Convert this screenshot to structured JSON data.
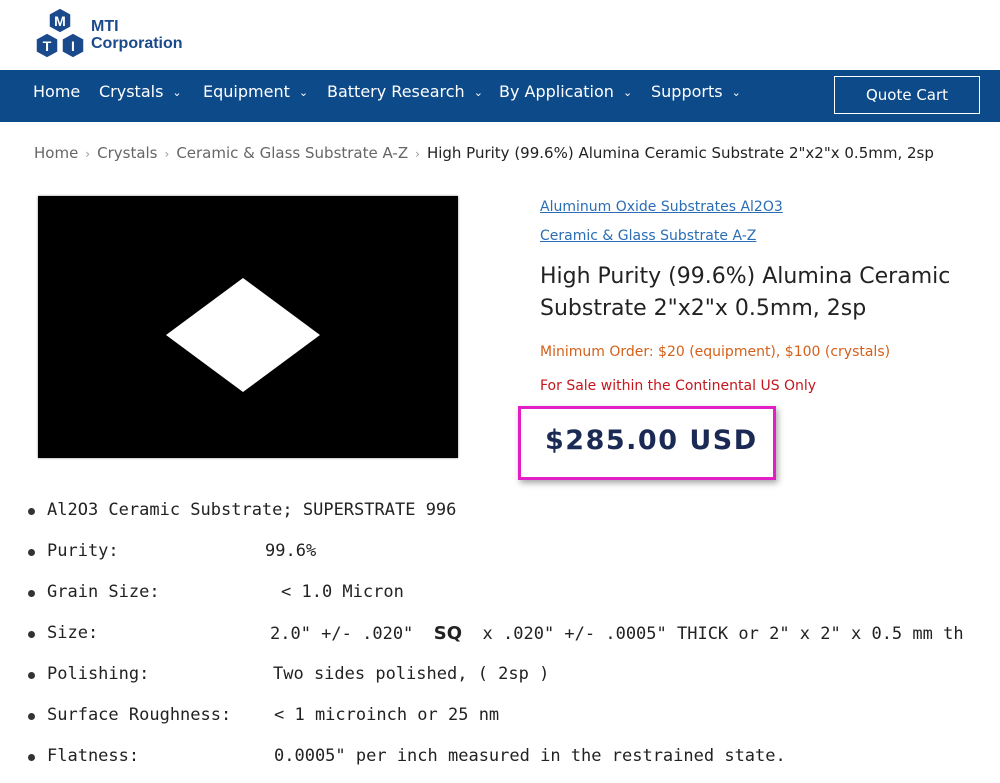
{
  "brand": {
    "logo_letters": [
      "M",
      "T",
      "I"
    ],
    "name_line1": "MTI",
    "name_line2": "Corporation",
    "color": "#1a4a8c"
  },
  "nav": {
    "items": [
      {
        "label": "Home",
        "has_dropdown": false
      },
      {
        "label": "Crystals",
        "has_dropdown": true
      },
      {
        "label": "Equipment",
        "has_dropdown": true
      },
      {
        "label": "Battery Research",
        "has_dropdown": true
      },
      {
        "label": "By Application",
        "has_dropdown": true
      },
      {
        "label": "Supports",
        "has_dropdown": true
      }
    ],
    "quote_cart": "Quote Cart",
    "background": "#0d4a8a"
  },
  "breadcrumb": {
    "items": [
      "Home",
      "Crystals",
      "Ceramic & Glass Substrate A-Z"
    ],
    "current": "High Purity (99.6%) Alumina Ceramic Substrate 2\"x2\"x 0.5mm, 2sp",
    "separator": "›"
  },
  "product": {
    "category_links": [
      "Aluminum Oxide Substrates Al2O3",
      "Ceramic & Glass Substrate A-Z"
    ],
    "title": "High Purity (99.6%) Alumina Ceramic Substrate 2\"x2\"x 0.5mm, 2sp",
    "min_order": "Minimum Order: $20 (equipment), $100 (crystals)",
    "sale_note": "For Sale within the Continental US Only",
    "price": "$285.00 USD",
    "price_highlight_color": "#e21fc7"
  },
  "specs": [
    {
      "label": "Al2O3 Ceramic Substrate; SUPERSTRATE 996",
      "value": ""
    },
    {
      "label": "Purity:",
      "value": "99.6%"
    },
    {
      "label": "Grain Size:",
      "value": "< 1.0 Micron"
    },
    {
      "label": "Size:",
      "value_pre": "2.0\" +/- .020\"",
      "value_sq": "SQ",
      "value_post": "x  .020\" +/- .0005\" THICK or 2\" x 2\" x 0.5 mm th"
    },
    {
      "label": "Polishing:",
      "value": "Two  sides  polished,  ( 2sp )"
    },
    {
      "label": "Surface Roughness:",
      "value": "< 1 microinch or 25 nm"
    },
    {
      "label": "Flatness:",
      "value": "0.0005\" per inch measured in the restrained state."
    }
  ]
}
